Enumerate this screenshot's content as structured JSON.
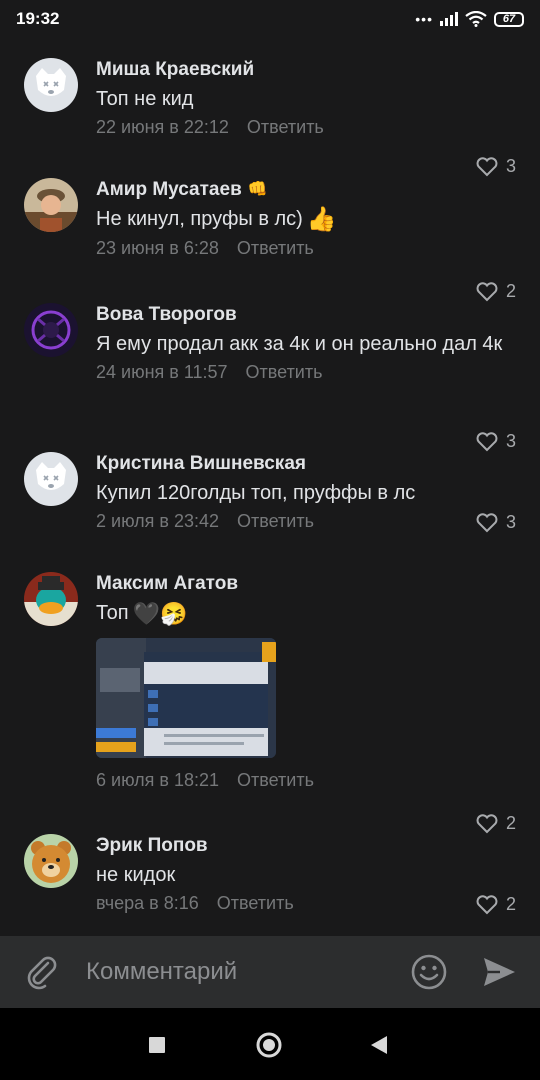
{
  "status_bar": {
    "time": "19:32",
    "battery": "67"
  },
  "comments": [
    {
      "name": "Миша Краевский",
      "text": "Топ не кид",
      "date": "22 июня в 22:12",
      "reply": "Ответить",
      "likes": "3",
      "avatar": "vk-dog-avatar"
    },
    {
      "name": "Амир Мусатаев",
      "name_emoji": "👊",
      "text": "Не кинул, пруфы в лс)",
      "text_emoji": "👍",
      "date": "23 июня в 6:28",
      "reply": "Ответить",
      "likes": "2",
      "avatar": "photo-avatar"
    },
    {
      "name": "Вова Творогов",
      "text": "Я ему продал акк за 4к и он реально дал 4к",
      "date": "24 июня в 11:57",
      "reply": "Ответить",
      "likes": "3",
      "avatar": "dark-purple-avatar"
    },
    {
      "name": "Кристина Вишневская",
      "text": "Купил 120голды топ, пруффы в лс",
      "date": "2 июля в 23:42",
      "reply": "Ответить",
      "likes": "3",
      "avatar": "vk-dog-avatar"
    },
    {
      "name": "Максим Агатов",
      "text": "Топ",
      "text_emoji": "🖤🤧",
      "date": "6 июля в 18:21",
      "reply": "Ответить",
      "likes": "2",
      "avatar": "platypus-avatar",
      "attachment": "game-screenshot-thumbnail"
    },
    {
      "name": "Эрик Попов",
      "text": "не кидок",
      "date": "вчера в 8:16",
      "reply": "Ответить",
      "likes": "2",
      "avatar": "bear-avatar"
    }
  ],
  "composer": {
    "placeholder": "Комментарий"
  },
  "icons": {
    "attach": "paperclip-icon",
    "emoji": "smile-icon",
    "send": "send-icon",
    "like": "heart-outline-icon",
    "nav": [
      "square-icon",
      "circle-icon",
      "triangle-back-icon"
    ]
  },
  "colors": {
    "background": "#19191a",
    "text": "#e1e3e6",
    "secondary": "#76787a",
    "composer": "#2c2d2e"
  }
}
